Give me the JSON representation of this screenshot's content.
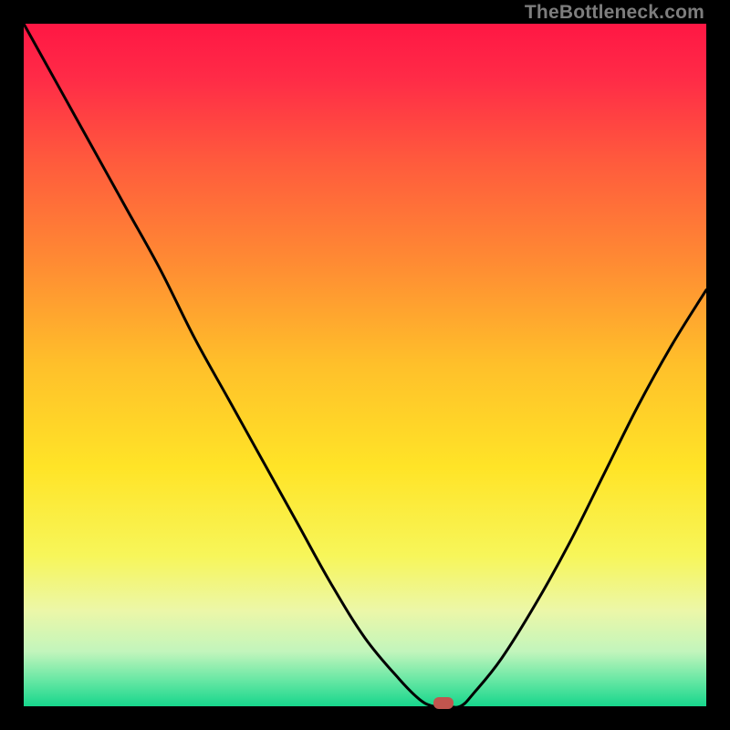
{
  "attribution": "TheBottleneck.com",
  "chart_data": {
    "type": "line",
    "title": "",
    "xlabel": "",
    "ylabel": "",
    "xlim": [
      0,
      100
    ],
    "ylim": [
      0,
      100
    ],
    "grid": false,
    "legend": false,
    "background": "rainbow-vertical-red-to-green",
    "series": [
      {
        "name": "curve",
        "x": [
          0,
          5,
          10,
          15,
          20,
          25,
          30,
          35,
          40,
          45,
          50,
          55,
          58,
          60,
          62,
          64,
          66,
          70,
          75,
          80,
          85,
          90,
          95,
          100
        ],
        "y": [
          100,
          91,
          82,
          73,
          64,
          54,
          45,
          36,
          27,
          18,
          10,
          4,
          1,
          0,
          0,
          0,
          2,
          7,
          15,
          24,
          34,
          44,
          53,
          61
        ]
      }
    ],
    "marker": {
      "x": 61.5,
      "y": 0.5,
      "color": "#c1554e"
    }
  },
  "colors": {
    "gradient_stops": [
      {
        "pos": 0.0,
        "color": "#ff1744"
      },
      {
        "pos": 0.08,
        "color": "#ff2b47"
      },
      {
        "pos": 0.2,
        "color": "#ff5a3d"
      },
      {
        "pos": 0.35,
        "color": "#ff8b33"
      },
      {
        "pos": 0.5,
        "color": "#ffc02a"
      },
      {
        "pos": 0.65,
        "color": "#ffe427"
      },
      {
        "pos": 0.78,
        "color": "#f7f65a"
      },
      {
        "pos": 0.86,
        "color": "#ecf7a8"
      },
      {
        "pos": 0.92,
        "color": "#c2f5bc"
      },
      {
        "pos": 0.96,
        "color": "#6be8a5"
      },
      {
        "pos": 1.0,
        "color": "#17d68c"
      }
    ],
    "curve_stroke": "#000000",
    "frame_border": "#000000"
  }
}
